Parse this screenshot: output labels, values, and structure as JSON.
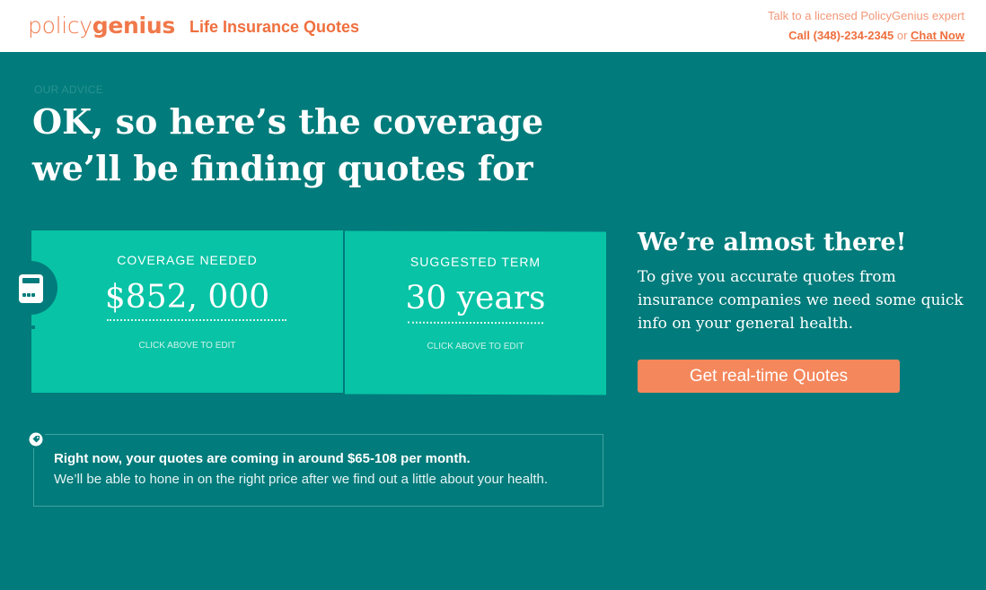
{
  "header": {
    "logo_light": "policy",
    "logo_bold": "genius",
    "title": "Life Insurance Quotes",
    "expert_text": "Talk to a licensed PolicyGenius expert",
    "phone_text": "Call (348)-234-2345",
    "or_text": "or",
    "chat_link": "Chat Now"
  },
  "advice": {
    "label": "OUR ADVICE",
    "headline": "OK, so here’s the coverage we’ll be finding quotes for"
  },
  "coverage": {
    "label": "COVERAGE NEEDED",
    "value": "$852, 000",
    "hint": "CLICK ABOVE TO EDIT"
  },
  "term": {
    "label": "SUGGESTED TERM",
    "value": "30 years",
    "hint": "CLICK ABOVE TO EDIT"
  },
  "next_step": {
    "title": "We’re almost there!",
    "description": "To give you accurate quotes from insurance companies we need some quick info on your general health.",
    "button_label": "Get real-time Quotes"
  },
  "estimate": {
    "headline": "Right now, your quotes are coming in around $65-108 per month.",
    "subtext": "We’ll be able to hone in on the right price after we find out a little about your health."
  },
  "icons": {
    "calculator": "calculator-icon",
    "price_tag": "price-tag-icon"
  },
  "colors": {
    "brand_orange": "#f0784a",
    "teal_background": "#017b7b",
    "card_green": "#08c3a5",
    "cta_orange": "#f4875c"
  }
}
